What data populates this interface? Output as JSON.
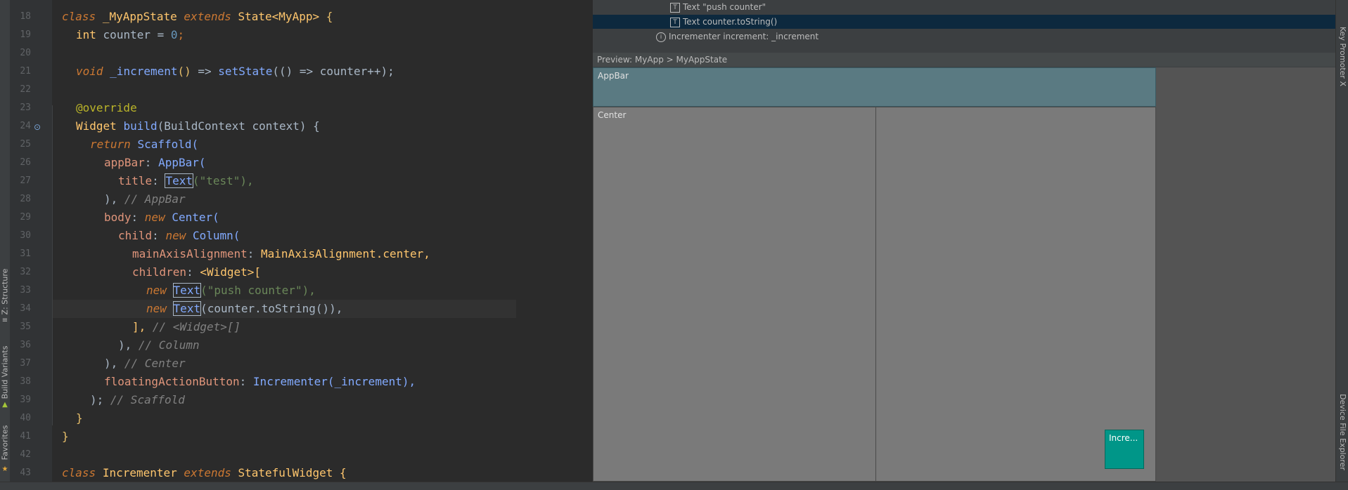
{
  "editor": {
    "lines": [
      {
        "num": "18"
      },
      {
        "num": "19"
      },
      {
        "num": "20"
      },
      {
        "num": "21"
      },
      {
        "num": "22"
      },
      {
        "num": "23"
      },
      {
        "num": "24"
      },
      {
        "num": "25"
      },
      {
        "num": "26"
      },
      {
        "num": "27"
      },
      {
        "num": "28"
      },
      {
        "num": "29"
      },
      {
        "num": "30"
      },
      {
        "num": "31"
      },
      {
        "num": "32"
      },
      {
        "num": "33"
      },
      {
        "num": "34"
      },
      {
        "num": "35"
      },
      {
        "num": "36"
      },
      {
        "num": "37"
      },
      {
        "num": "38"
      },
      {
        "num": "39"
      },
      {
        "num": "40"
      },
      {
        "num": "41"
      },
      {
        "num": "42"
      },
      {
        "num": "43"
      }
    ],
    "tokens": {
      "l18_class": "class",
      "l18_name": "_MyAppState",
      "l18_extends": "extends",
      "l18_super": "State<MyApp>",
      "l18_brace": "{",
      "l19_int": "int",
      "l19_rest": "counter = ",
      "l19_num": "0",
      "l19_semi": ";",
      "l21_void": "void",
      "l21_fn": "_increment",
      "l21_paren": "()",
      "l21_arrow": " => ",
      "l21_setstate": "setState",
      "l21_rest": "(() => counter++);",
      "l23_ann": "@override",
      "l24_widget": "Widget",
      "l24_build": "build",
      "l24_ctx": "(BuildContext context) {",
      "l25_return": "return",
      "l25_scaffold": "Scaffold(",
      "l26_appbar": "appBar",
      "l26_appbarcls": "AppBar(",
      "l27_title": "title",
      "l27_text": "Text",
      "l27_str": "(\"test\"),",
      "l28_close": "),",
      "l28_cm": "// AppBar",
      "l29_body": "body",
      "l29_new": "new",
      "l29_center": "Center(",
      "l30_child": "child",
      "l30_new": "new",
      "l30_column": "Column(",
      "l31_prop": "mainAxisAlignment",
      "l31_val": "MainAxisAlignment.center,",
      "l32_children": "children",
      "l32_val": "<Widget>[",
      "l33_new": "new",
      "l33_text": "Text",
      "l33_str": "(\"push counter\"),",
      "l34_new": "new",
      "l34_text": "Text",
      "l34_rest": "(counter.toString()),",
      "l35_close": "],",
      "l35_cm": "// <Widget>[]",
      "l36_close": "),",
      "l36_cm": "// Column",
      "l37_close": "),",
      "l37_cm": "// Center",
      "l38_prop": "floatingActionButton",
      "l38_val": "Incrementer(_increment),",
      "l39_close": ");",
      "l39_cm": "// Scaffold",
      "l40_close": "}",
      "l41_close": "}",
      "l43_class": "class",
      "l43_name": "Incrementer",
      "l43_extends": "extends",
      "l43_super": "StatefulWidget {"
    }
  },
  "outline_tree": {
    "items": [
      {
        "label": "Text \"push counter\""
      },
      {
        "label": "Text counter.toString()"
      },
      {
        "label": "Incrementer increment: _increment"
      }
    ]
  },
  "preview": {
    "header": "Preview: MyApp > MyAppState",
    "appbar_label": "AppBar",
    "center_label": "Center",
    "fab_label": "Incre..."
  },
  "left_tabs": {
    "structure": "Z: Structure",
    "build_variants": "Build Variants",
    "favorites": "Favorites"
  },
  "right_tabs": {
    "key_promoter": "Key Promoter X",
    "device_file_explorer": "Device File Explorer"
  }
}
